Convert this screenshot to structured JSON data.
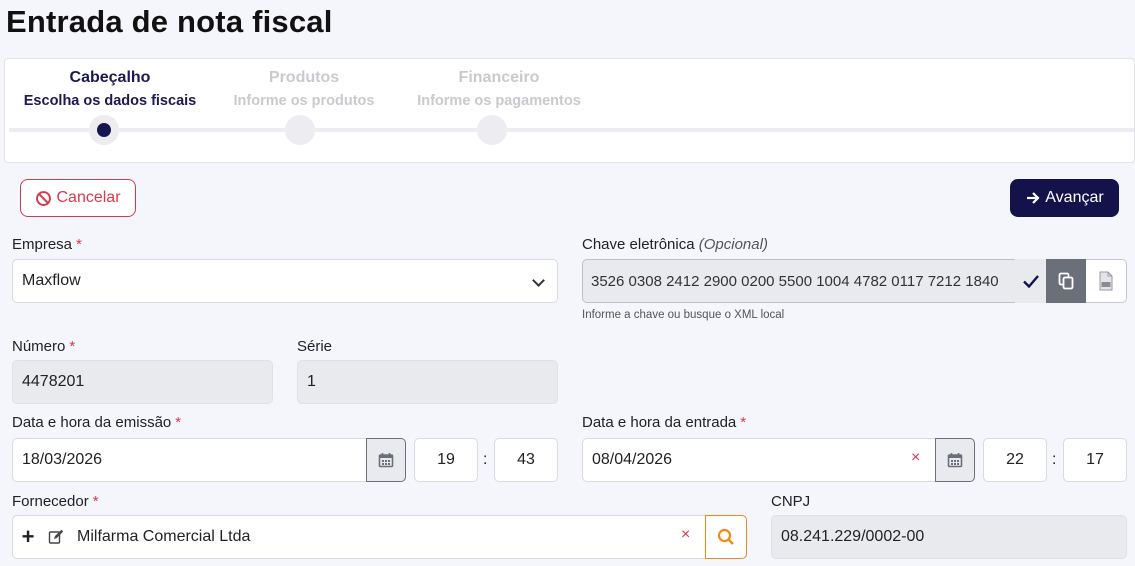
{
  "page": {
    "title": "Entrada de nota fiscal"
  },
  "stepper": {
    "steps": [
      {
        "title": "Cabeçalho",
        "subtitle": "Escolha os dados fiscais"
      },
      {
        "title": "Produtos",
        "subtitle": "Informe os produtos"
      },
      {
        "title": "Financeiro",
        "subtitle": "Informe os pagamentos"
      }
    ]
  },
  "actions": {
    "cancel_label": "Cancelar",
    "next_label": "Avançar"
  },
  "form": {
    "empresa": {
      "label": "Empresa",
      "required_mark": "*",
      "value": "Maxflow"
    },
    "chave": {
      "label": "Chave eletrônica",
      "optional_text": "(Opcional)",
      "value": "3526 0308 2412 2900 0200 5500 1004 4782 0117 7212 1840",
      "helper": "Informe a chave ou busque o XML local"
    },
    "numero": {
      "label": "Número",
      "required_mark": "*",
      "value": "4478201"
    },
    "serie": {
      "label": "Série",
      "value": "1"
    },
    "emissao": {
      "label": "Data e hora da emissão",
      "required_mark": "*",
      "date": "18/03/2026",
      "hour": "19",
      "minute": "43",
      "separator": ":"
    },
    "entrada": {
      "label": "Data e hora da entrada",
      "required_mark": "*",
      "date": "08/04/2026",
      "hour": "22",
      "minute": "17",
      "separator": ":",
      "clear_symbol": "×"
    },
    "fornecedor": {
      "label": "Fornecedor",
      "required_mark": "*",
      "value": "Milfarma Comercial Ltda",
      "add_symbol": "+",
      "clear_symbol": "×"
    },
    "cnpj": {
      "label": "CNPJ",
      "value": "08.241.229/0002-00"
    }
  },
  "colors": {
    "primary": "#14124a",
    "danger": "#d43a4f",
    "accent": "#f08a16",
    "readonly_bg": "#e9eaee"
  },
  "icons": [
    "cancel-circle-icon",
    "arrow-right-icon",
    "chevron-down-icon",
    "check-icon",
    "copy-icon",
    "pdf-file-icon",
    "calendar-icon",
    "clear-icon",
    "add-icon",
    "edit-icon",
    "search-icon"
  ]
}
